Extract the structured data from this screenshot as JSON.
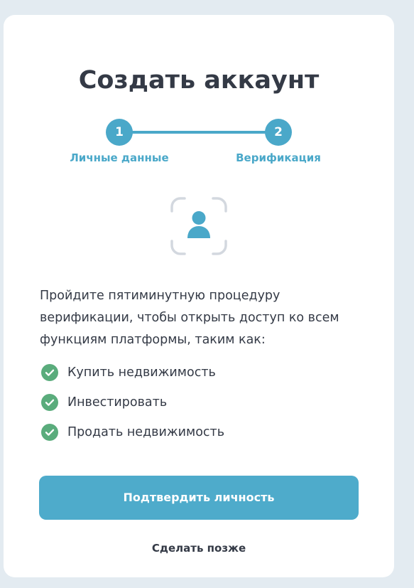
{
  "page": {
    "title": "Создать аккаунт"
  },
  "stepper": {
    "steps": [
      {
        "number": "1",
        "label": "Личные данные"
      },
      {
        "number": "2",
        "label": "Верификация"
      }
    ],
    "current_step": 2,
    "accent_color": "#4aa8c9"
  },
  "verification": {
    "icon": "face-scan-icon",
    "description": "Пройдите пятиминутную процедуру верификации, чтобы открыть доступ ко всем функциям платформы, таким как:",
    "features": [
      {
        "icon": "check-circle-icon",
        "label": "Купить недвижимость"
      },
      {
        "icon": "check-circle-icon",
        "label": "Инвестировать"
      },
      {
        "icon": "check-circle-icon",
        "label": "Продать недвижимость"
      }
    ],
    "check_color": "#5aac7c"
  },
  "actions": {
    "confirm_label": "Подтвердить личность",
    "later_label": "Сделать позже",
    "button_color": "#4eabcb"
  }
}
